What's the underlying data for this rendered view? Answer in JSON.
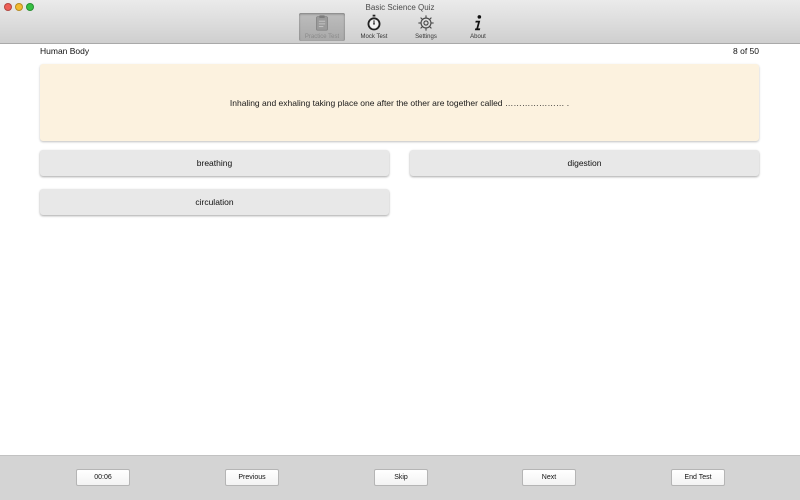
{
  "window": {
    "title": "Basic Science Quiz"
  },
  "toolbar": {
    "items": [
      {
        "label": "Practice Test",
        "icon": "clipboard-icon",
        "selected": true
      },
      {
        "label": "Mock Test",
        "icon": "stopwatch-icon",
        "selected": false
      },
      {
        "label": "Settings",
        "icon": "gear-icon",
        "selected": false
      },
      {
        "label": "About",
        "icon": "info-icon",
        "selected": false
      }
    ]
  },
  "quiz": {
    "topic": "Human Body",
    "counter": "8 of 50",
    "question": "Inhaling and exhaling taking place one after the other are together called ………………… .",
    "answers": [
      "breathing",
      "digestion",
      "circulation"
    ]
  },
  "footer": {
    "timer": "00:06",
    "previous": "Previous",
    "skip": "Skip",
    "next": "Next",
    "end_test": "End Test"
  },
  "colors": {
    "question_bg": "#fcf2df",
    "answer_bg": "#e8e8e8",
    "bottom_bar_bg": "#d4d4d4"
  }
}
